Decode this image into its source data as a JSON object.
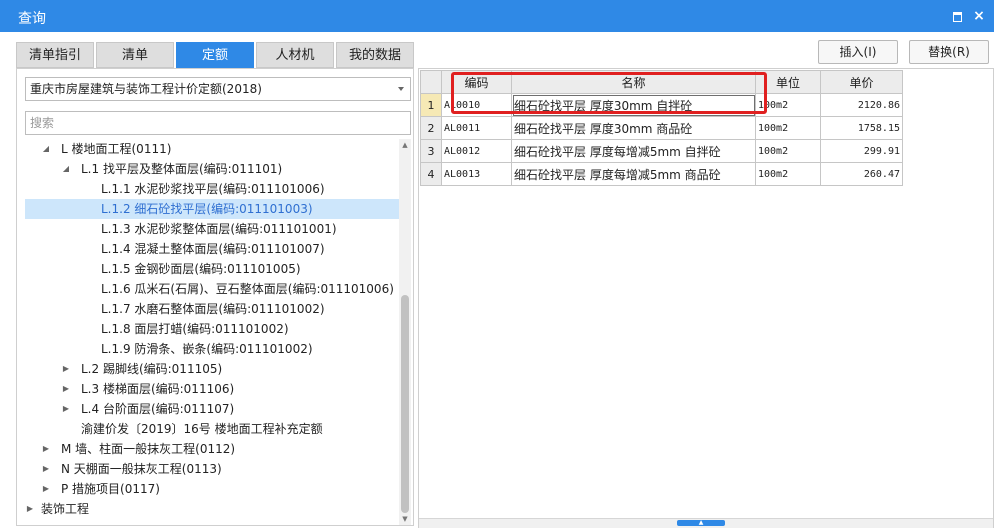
{
  "window": {
    "title": "查询",
    "maximize_icon": "maximize-icon",
    "close_icon": "close-icon",
    "close_glyph": "×"
  },
  "tabs": [
    {
      "label": "清单指引",
      "active": false
    },
    {
      "label": "清单",
      "active": false
    },
    {
      "label": "定额",
      "active": true
    },
    {
      "label": "人材机",
      "active": false
    },
    {
      "label": "我的数据",
      "active": false
    }
  ],
  "actions": {
    "insert_label": "插入(I)",
    "replace_label": "替换(R)"
  },
  "library_select": {
    "value": "重庆市房屋建筑与装饰工程计价定额(2018)"
  },
  "search": {
    "placeholder": "搜索"
  },
  "tree": [
    {
      "label": "L 楼地面工程(0111)",
      "toggle": "◢",
      "level": 1
    },
    {
      "label": "L.1 找平层及整体面层(编码:011101)",
      "toggle": "◢",
      "level": 2
    },
    {
      "label": "L.1.1 水泥砂浆找平层(编码:011101006)",
      "toggle": "",
      "level": 3
    },
    {
      "label": "L.1.2 细石砼找平层(编码:011101003)",
      "toggle": "",
      "level": 3,
      "selected": true
    },
    {
      "label": "L.1.3 水泥砂浆整体面层(编码:011101001)",
      "toggle": "",
      "level": 3
    },
    {
      "label": "L.1.4 混凝土整体面层(编码:011101007)",
      "toggle": "",
      "level": 3
    },
    {
      "label": "L.1.5 金钢砂面层(编码:011101005)",
      "toggle": "",
      "level": 3
    },
    {
      "label": "L.1.6 瓜米石(石屑)、豆石整体面层(编码:011101006)",
      "toggle": "",
      "level": 3
    },
    {
      "label": "L.1.7 水磨石整体面层(编码:011101002)",
      "toggle": "",
      "level": 3
    },
    {
      "label": "L.1.8 面层打蜡(编码:011101002)",
      "toggle": "",
      "level": 3
    },
    {
      "label": "L.1.9 防滑条、嵌条(编码:011101002)",
      "toggle": "",
      "level": 3
    },
    {
      "label": "L.2 踢脚线(编码:011105)",
      "toggle": "▶",
      "level": 2
    },
    {
      "label": "L.3 楼梯面层(编码:011106)",
      "toggle": "▶",
      "level": 2
    },
    {
      "label": "L.4 台阶面层(编码:011107)",
      "toggle": "▶",
      "level": 2
    },
    {
      "label": "渝建价发〔2019〕16号 楼地面工程补充定额",
      "toggle": "",
      "level": 2
    },
    {
      "label": "M 墙、柱面一般抹灰工程(0112)",
      "toggle": "▶",
      "level": 1
    },
    {
      "label": "N 天棚面一般抹灰工程(0113)",
      "toggle": "▶",
      "level": 1
    },
    {
      "label": "P 措施项目(0117)",
      "toggle": "▶",
      "level": 1
    },
    {
      "label": "装饰工程",
      "toggle": "▶",
      "level": 0
    }
  ],
  "grid": {
    "columns": [
      "编码",
      "名称",
      "单位",
      "单价"
    ],
    "rows": [
      {
        "num": "1",
        "code": "AL0010",
        "name": "细石砼找平层 厚度30mm 自拌砼",
        "unit": "100m2",
        "price": "2120.86",
        "current": true
      },
      {
        "num": "2",
        "code": "AL0011",
        "name": "细石砼找平层 厚度30mm 商品砼",
        "unit": "100m2",
        "price": "1758.15"
      },
      {
        "num": "3",
        "code": "AL0012",
        "name": "细石砼找平层 厚度每增减5mm 自拌砼",
        "unit": "100m2",
        "price": "299.91"
      },
      {
        "num": "4",
        "code": "AL0013",
        "name": "细石砼找平层 厚度每增减5mm 商品砼",
        "unit": "100m2",
        "price": "260.47"
      }
    ]
  },
  "colors": {
    "accent": "#2f89e6",
    "highlight_box": "#e02020",
    "selected_row_bg": "#cde6fb"
  }
}
